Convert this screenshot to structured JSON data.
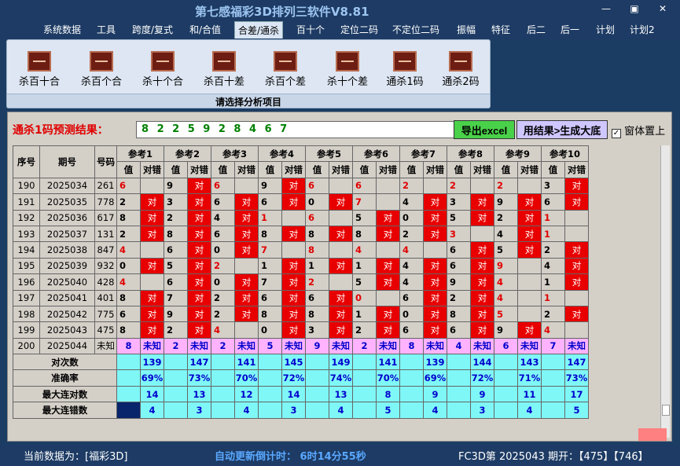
{
  "app": {
    "title": "第七感福彩3D排列三软件V8.81",
    "win_min": "—",
    "win_max": "▣",
    "win_close": "✕"
  },
  "menu": [
    "系统数据",
    "工具",
    "跨度/复式",
    "和/合值",
    "合差/通杀",
    "百十个",
    "定位二码",
    "不定位二码",
    "振幅",
    "特征",
    "后二",
    "后一",
    "计划",
    "计划2"
  ],
  "ribbon": {
    "buttons": [
      "杀百十合",
      "杀百个合",
      "杀十个合",
      "杀百十差",
      "杀百个差",
      "杀十个差",
      "通杀1码",
      "通杀2码"
    ],
    "caption": "请选择分析项目"
  },
  "prediction": {
    "label": "通杀1码预测结果：",
    "digits": "8 2 2 5 9 2 8 4 6 7",
    "excel_button": "导出excel",
    "generate_button": "用结果>生成大底",
    "topmost_label": "窗体置上",
    "topmost_checked": "✓"
  },
  "table": {
    "head_seq": "序号",
    "head_period": "期号",
    "head_num": "号码",
    "refs": [
      "参考1",
      "参考2",
      "参考3",
      "参考4",
      "参考5",
      "参考6",
      "参考7",
      "参考8",
      "参考9",
      "参考10"
    ],
    "sub_val": "值",
    "sub_hit": "对错",
    "hit": "对",
    "unknown": "未知",
    "rows": [
      {
        "seq": "190",
        "period": "2025034",
        "num": "261",
        "vals": [
          6,
          9,
          6,
          9,
          6,
          6,
          2,
          2,
          2,
          3
        ],
        "hits": [
          0,
          1,
          0,
          1,
          0,
          0,
          0,
          0,
          0,
          1
        ],
        "red": [
          1,
          0,
          1,
          0,
          1,
          1,
          1,
          1,
          1,
          0
        ]
      },
      {
        "seq": "191",
        "period": "2025035",
        "num": "778",
        "vals": [
          2,
          3,
          6,
          6,
          0,
          7,
          4,
          3,
          9,
          6
        ],
        "hits": [
          1,
          1,
          1,
          1,
          1,
          0,
          1,
          1,
          1,
          1
        ],
        "red": [
          0,
          0,
          0,
          0,
          0,
          1,
          0,
          0,
          0,
          0
        ]
      },
      {
        "seq": "192",
        "period": "2025036",
        "num": "617",
        "vals": [
          8,
          2,
          4,
          1,
          6,
          5,
          0,
          5,
          2,
          1
        ],
        "hits": [
          1,
          1,
          1,
          0,
          0,
          1,
          1,
          1,
          1,
          0
        ],
        "red": [
          0,
          0,
          0,
          1,
          1,
          0,
          0,
          0,
          0,
          1
        ]
      },
      {
        "seq": "193",
        "period": "2025037",
        "num": "131",
        "vals": [
          2,
          8,
          6,
          8,
          8,
          8,
          2,
          3,
          4,
          1
        ],
        "hits": [
          1,
          1,
          1,
          1,
          1,
          1,
          1,
          0,
          1,
          0
        ],
        "red": [
          0,
          0,
          0,
          0,
          0,
          0,
          0,
          1,
          0,
          1
        ]
      },
      {
        "seq": "194",
        "period": "2025038",
        "num": "847",
        "vals": [
          4,
          6,
          0,
          7,
          8,
          4,
          4,
          6,
          5,
          2
        ],
        "hits": [
          0,
          1,
          1,
          0,
          0,
          0,
          0,
          1,
          1,
          1
        ],
        "red": [
          1,
          0,
          0,
          1,
          1,
          1,
          1,
          0,
          0,
          0
        ]
      },
      {
        "seq": "195",
        "period": "2025039",
        "num": "932",
        "vals": [
          0,
          5,
          2,
          1,
          1,
          1,
          4,
          6,
          9,
          4
        ],
        "hits": [
          1,
          1,
          0,
          1,
          1,
          1,
          1,
          1,
          0,
          1
        ],
        "red": [
          0,
          0,
          1,
          0,
          0,
          0,
          0,
          0,
          1,
          0
        ]
      },
      {
        "seq": "196",
        "period": "2025040",
        "num": "428",
        "vals": [
          4,
          6,
          0,
          7,
          2,
          5,
          4,
          9,
          4,
          1
        ],
        "hits": [
          0,
          1,
          1,
          1,
          0,
          1,
          1,
          1,
          0,
          1
        ],
        "red": [
          1,
          0,
          0,
          0,
          1,
          0,
          0,
          0,
          1,
          0
        ]
      },
      {
        "seq": "197",
        "period": "2025041",
        "num": "401",
        "vals": [
          8,
          7,
          2,
          6,
          6,
          0,
          6,
          2,
          4,
          1
        ],
        "hits": [
          1,
          1,
          1,
          1,
          1,
          0,
          1,
          1,
          0,
          0
        ],
        "red": [
          0,
          0,
          0,
          0,
          0,
          1,
          0,
          0,
          1,
          1
        ]
      },
      {
        "seq": "198",
        "period": "2025042",
        "num": "775",
        "vals": [
          6,
          9,
          2,
          8,
          8,
          1,
          0,
          8,
          5,
          2
        ],
        "hits": [
          1,
          1,
          1,
          1,
          1,
          1,
          1,
          1,
          0,
          1
        ],
        "red": [
          0,
          0,
          0,
          0,
          0,
          0,
          0,
          0,
          1,
          0
        ]
      },
      {
        "seq": "199",
        "period": "2025043",
        "num": "475",
        "vals": [
          8,
          2,
          4,
          0,
          3,
          2,
          6,
          6,
          9,
          4
        ],
        "hits": [
          1,
          1,
          0,
          1,
          1,
          1,
          1,
          1,
          1,
          0
        ],
        "red": [
          0,
          0,
          1,
          0,
          0,
          0,
          0,
          0,
          0,
          1
        ]
      }
    ],
    "pred_row": {
      "seq": "200",
      "period": "2025044",
      "num": "未知",
      "vals": [
        8,
        2,
        2,
        5,
        9,
        2,
        8,
        4,
        6,
        7
      ]
    },
    "stats": [
      {
        "label": "对次数",
        "vals": [
          "139",
          "147",
          "141",
          "145",
          "149",
          "141",
          "139",
          "144",
          "143",
          "147"
        ]
      },
      {
        "label": "准确率",
        "vals": [
          "69%",
          "73%",
          "70%",
          "72%",
          "74%",
          "70%",
          "69%",
          "72%",
          "71%",
          "73%"
        ]
      },
      {
        "label": "最大连对数",
        "vals": [
          "14",
          "13",
          "12",
          "14",
          "13",
          "8",
          "9",
          "9",
          "11",
          "17"
        ]
      },
      {
        "label": "最大连错数",
        "vals": [
          "4",
          "3",
          "4",
          "3",
          "4",
          "5",
          "4",
          "3",
          "4",
          "5"
        ]
      }
    ]
  },
  "status": {
    "current_data": "当前数据为：[福彩3D]",
    "countdown": "自动更新倒计时：  6时14分55秒",
    "draw": "FC3D第 2025043 期开：【475】【746】"
  },
  "colors": {
    "hit_red": "#e80000",
    "predict_row": "#ffb3ff",
    "stats_cyan": "#7ff7f7",
    "prediction_green": "#008000"
  }
}
